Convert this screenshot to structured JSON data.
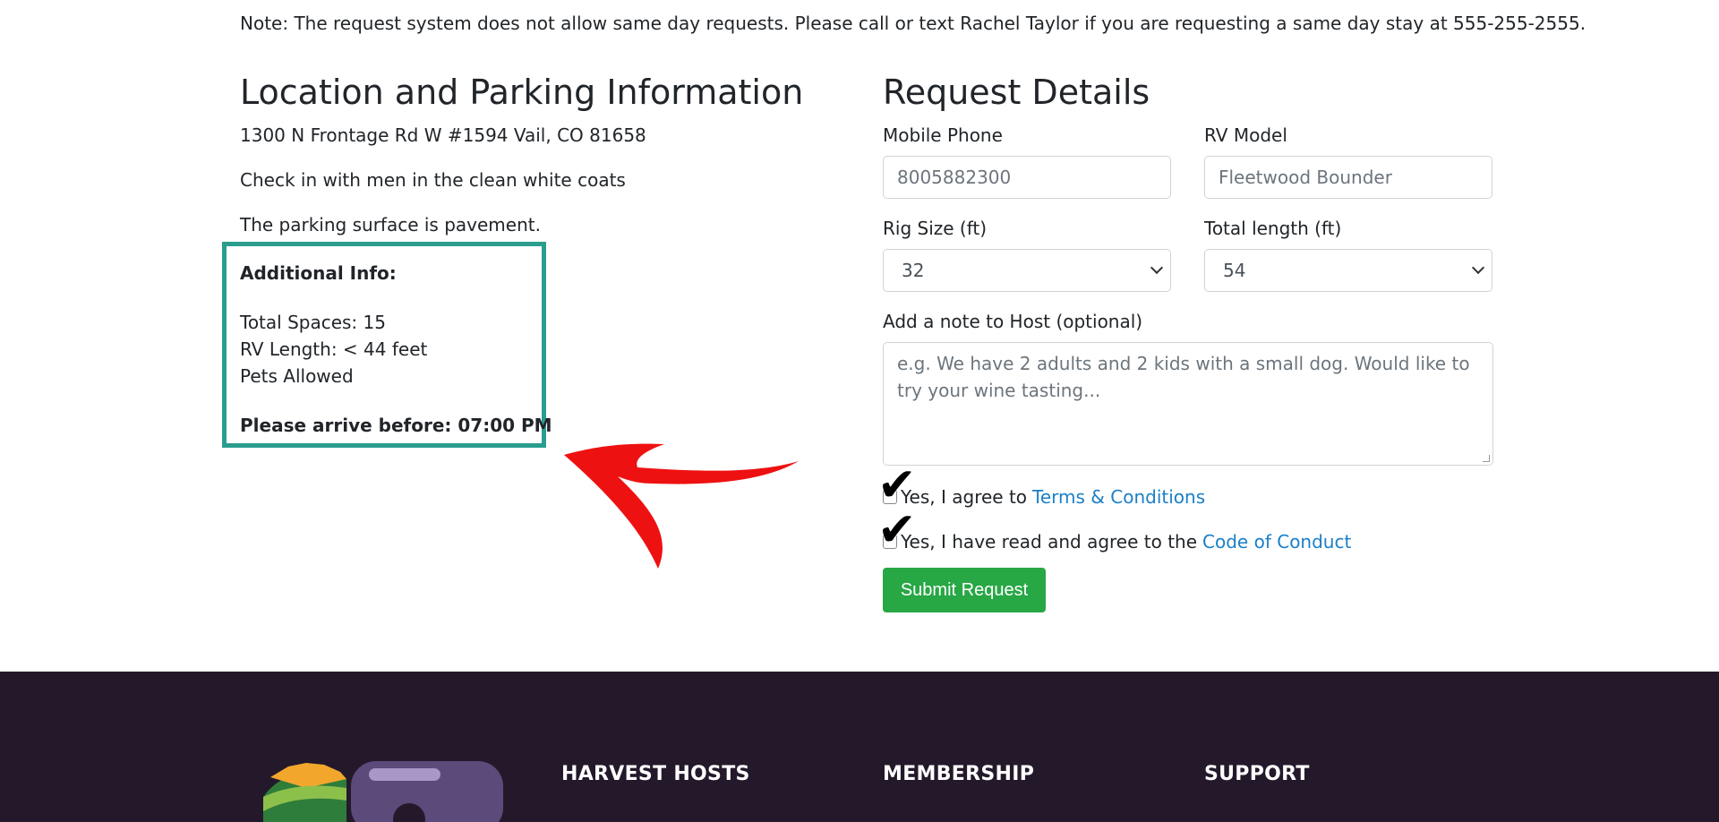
{
  "note": "Note: The request system does not allow same day requests. Please call or text Rachel Taylor if you are requesting a same day stay at 555-255-2555.",
  "location": {
    "title": "Location and Parking Information",
    "address": "1300 N Frontage Rd W #1594 Vail, CO 81658",
    "checkin": "Check in with men in the clean white coats",
    "surface": "The parking surface is pavement.",
    "additional_title": "Additional Info:",
    "total_spaces": "Total Spaces: 15",
    "rv_length": "RV Length: < 44 feet",
    "pets": "Pets Allowed",
    "arrive": "Please arrive before: 07:00 PM"
  },
  "request": {
    "title": "Request Details",
    "mobile_label": "Mobile Phone",
    "mobile_value": "8005882300",
    "rv_model_label": "RV Model",
    "rv_model_value": "Fleetwood Bounder",
    "rig_size_label": "Rig Size (ft)",
    "rig_size_value": "32",
    "total_length_label": "Total length (ft)",
    "total_length_value": "54",
    "note_label": "Add a note to Host (optional)",
    "note_placeholder": "e.g. We have 2 adults and 2 kids with a small dog. Would like to try your wine tasting...",
    "agree_terms_text": "Yes, I agree to",
    "terms_link": "Terms & Conditions",
    "agree_conduct_text": "Yes, I have read and agree to the",
    "conduct_link": "Code of Conduct",
    "submit_label": "Submit Request"
  },
  "footer": {
    "col1": "HARVEST HOSTS",
    "col2": "MEMBERSHIP",
    "col3": "SUPPORT"
  },
  "colors": {
    "accent_box": "#2a9d8f",
    "submit": "#28a745",
    "link": "#1a7fc9",
    "footer_bg": "#24192b",
    "arrow": "#ee1111"
  }
}
